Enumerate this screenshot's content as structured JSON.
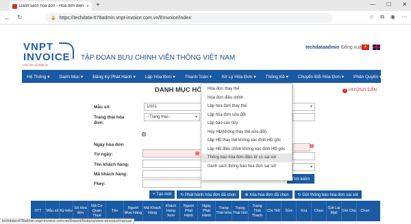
{
  "browser": {
    "tab_title": "Danh sách hóa đơn - Hóa đơn điện tử",
    "url": "https://techdata-tt78admin.vnpt-invoice.com.vn/EInvoice/index",
    "status_url": "techdata-tt78admin.vnpt-invoice.com.vn/Report/Notices/view-einvoice/manual"
  },
  "header": {
    "logo_line1": "VNPT",
    "logo_line2": "INVOICE",
    "logo_slogan": "Hóa đơn kỹ thuật số",
    "brand_title": "TẬP ĐOÀN BƯU CHÍNH VIỄN THÔNG VIỆT NAM",
    "username": "techdataadmin",
    "logout_label": "Đăng xuất"
  },
  "menu": [
    {
      "label": "Hệ Thống ▾"
    },
    {
      "label": "Danh Mục ▾"
    },
    {
      "label": "Đăng Ký Phát Hành ▾"
    },
    {
      "label": "Lập Hóa Đơn ▾"
    },
    {
      "label": "Thanh Toán ▾"
    },
    {
      "label": "Xử Lý Hóa Đơn ▾"
    },
    {
      "label": "Thống Kê ▾"
    },
    {
      "label": "Chuyển Đổi Hóa Đơn ▾"
    },
    {
      "label": "Phân Quyền ▾"
    }
  ],
  "page": {
    "title": "DANH MỤC HÓA",
    "help_label": "HƯỚNG DẪN"
  },
  "form": {
    "mau_so_label": "Mẫu số:",
    "mau_so_value": "1/001",
    "trang_thai_label": "Trạng thái hóa đơn:",
    "trang_thai_value": "--Trạng thái--",
    "ngay_label": "Ngày hóa đơn",
    "tu_ngay_label": "Từ ngày:",
    "ten_kh_label": "Tên khách hàng:",
    "ma_kh_label": "Mã khách hàng:",
    "fkey_label": "Fkey:",
    "search_label": "Tìm kiếm"
  },
  "toolbar": [
    {
      "label": "+ Tạo mới"
    },
    {
      "label": "↻ Phát hành hóa đơn đã chọn"
    },
    {
      "label": "⊗ Xóa hóa đơn đã chọn"
    },
    {
      "label": "↻ Gửi thông báo hóa đơn sai sót"
    }
  ],
  "table_headers": [
    "STT",
    "Mẫu số",
    "Ký hiệu",
    "Số Hóa đơn",
    "Mã Cơ Quan Thuế",
    "Tên",
    "Người Mua Hàng",
    "Mã Khách Hàng",
    "Khách Hàng Xem",
    "Người Phát Hành",
    "Ngày Phát Hành",
    "Trạng Thái Hóa",
    "Trạng Thái Gửi",
    "Trạng Thái Thanh",
    "Chi Tiết",
    "Sửa",
    "Xóa",
    "Chọn",
    "Gửi Lại Mail",
    "Ghi Chú",
    "Chọn"
  ],
  "dropdown": [
    "Hóa đơn thay thế",
    "Hóa đơn điều chỉnh",
    "Lập hóa đơn thay thế",
    "Lập hóa đơn sửa đổi",
    "Lập báo cáo hủy",
    "Hủy HĐ(không thay thế,sửa đổi)",
    "Lập HĐ thay thế không xác định HĐ gốc",
    "Lập HĐ điều chỉnh không xác định HĐ gốc",
    "Thông báo hóa đơn điện tử có sai sót",
    "Danh sách thông báo hoá đơn sai sót"
  ],
  "colors": {
    "accent": "#1a5aa3",
    "brand_red": "#d32f2f",
    "dropdown_hover": "#e6e6e6"
  }
}
